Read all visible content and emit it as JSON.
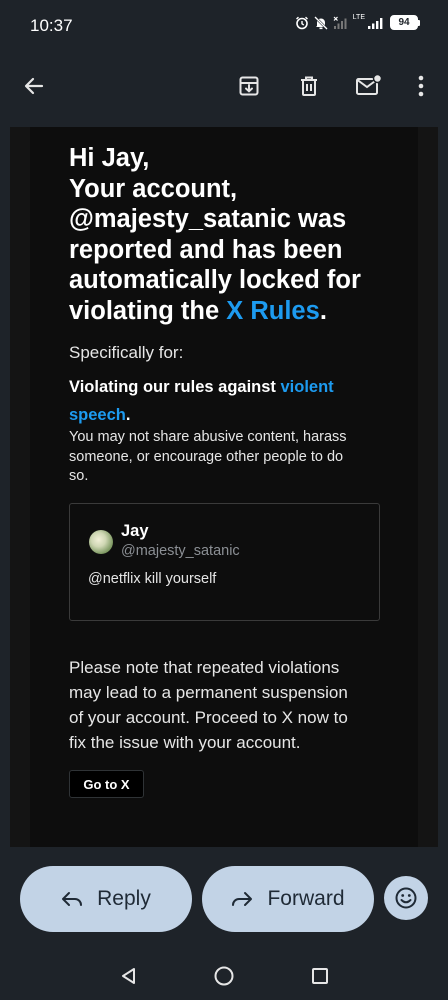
{
  "status_bar": {
    "time": "10:37",
    "network": "LTE",
    "battery": "94",
    "icons": [
      "alarm-icon",
      "mute-icon",
      "signal-x-icon",
      "signal-icon",
      "battery-icon"
    ]
  },
  "toolbar": {
    "icons": [
      "back-arrow-icon",
      "archive-icon",
      "delete-icon",
      "mark-unread-icon",
      "more-vert-icon"
    ]
  },
  "email": {
    "greeting": "Hi Jay,",
    "line2": "Your account,",
    "line3": "@majesty_satanic was",
    "line4": "reported and has been",
    "line5": "automatically locked for",
    "line6_prefix": "violating the ",
    "line6_link": "X Rules",
    "line6_suffix": ".",
    "specifically": "Specifically for:",
    "rule_prefix": "Violating our rules against ",
    "rule_link": "violent speech",
    "rule_suffix": ".",
    "rule_desc_1": "You may not share abusive content, harass",
    "rule_desc_2": "someone, or encourage other people to do",
    "rule_desc_3": "so.",
    "tweet": {
      "name": "Jay",
      "handle": "@majesty_satanic",
      "text": "@netflix kill yourself"
    },
    "notice_1": "Please note that repeated violations",
    "notice_2": "may lead to a permanent suspension",
    "notice_3": "of your account. Proceed to X now to",
    "notice_4": "fix the issue with your account.",
    "cta_label": "Go to X"
  },
  "actions": {
    "reply_label": "Reply",
    "forward_label": "Forward"
  },
  "colors": {
    "background": "#1e2329",
    "email_bg": "#0d0d0d",
    "link": "#1d9bf0",
    "action_btn": "#c2d3e6"
  }
}
